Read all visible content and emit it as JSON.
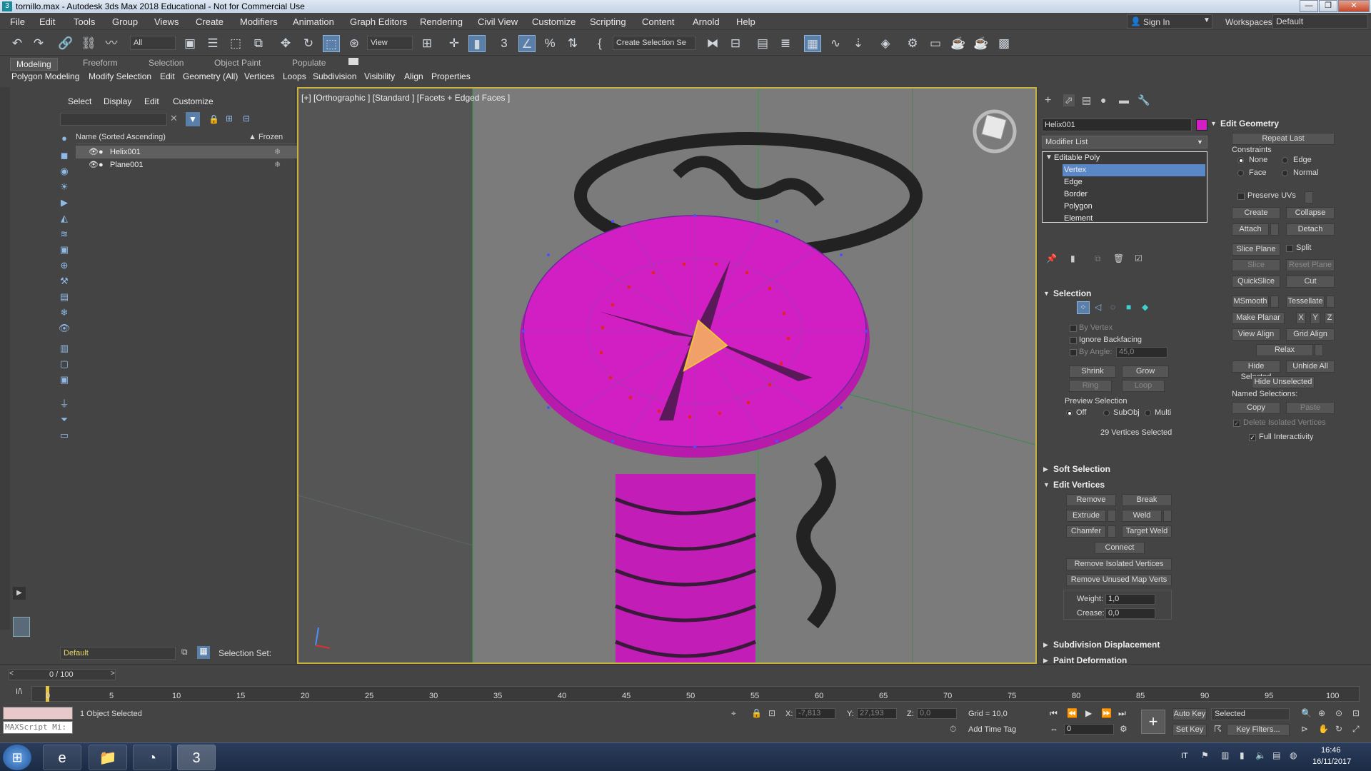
{
  "window": {
    "title": "tornillo.max - Autodesk 3ds Max 2018 Educational - Not for Commercial Use",
    "controls": [
      "—",
      "❐",
      "✕"
    ]
  },
  "menu": [
    "File",
    "Edit",
    "Tools",
    "Group",
    "Views",
    "Create",
    "Modifiers",
    "Animation",
    "Graph Editors",
    "Rendering",
    "Civil View",
    "Customize",
    "Scripting",
    "Content",
    "Arnold",
    "Help"
  ],
  "account": {
    "sign_in": "Sign In",
    "workspaces_label": "Workspaces:",
    "workspace": "Default"
  },
  "toolbar": {
    "filter": "All",
    "view": "View",
    "selection_set": "Create Selection Se"
  },
  "ribbon": {
    "tabs": [
      "Modeling",
      "Freeform",
      "Selection",
      "Object Paint",
      "Populate"
    ],
    "sub": [
      "Polygon Modeling",
      "Modify Selection",
      "Edit",
      "Geometry (All)",
      "Vertices",
      "Loops",
      "Subdivision",
      "Visibility",
      "Align",
      "Properties"
    ]
  },
  "scene_explorer": {
    "tabs": [
      "Select",
      "Display",
      "Edit",
      "Customize"
    ],
    "col_name": "Name (Sorted Ascending)",
    "col_frozen": "▲ Frozen",
    "rows": [
      "Helix001",
      "Plane001"
    ],
    "layer": "Default",
    "selection_set_label": "Selection Set:"
  },
  "viewport": {
    "label": "[+] [Orthographic ] [Standard ] [Facets + Edged Faces ]",
    "mesh_color": "#d21fc4",
    "vertex_color": "#e0232b"
  },
  "command_panel": {
    "object_name": "Helix001",
    "object_color": "#d21fc4",
    "modifier_list": "Modifier List",
    "stack": [
      "Editable Poly",
      "Vertex",
      "Edge",
      "Border",
      "Polygon",
      "Element"
    ],
    "selection": {
      "title": "Selection",
      "by_vertex": "By Vertex",
      "ignore_backfacing": "Ignore Backfacing",
      "by_angle": "By Angle:",
      "by_angle_value": "45,0",
      "shrink": "Shrink",
      "grow": "Grow",
      "ring": "Ring",
      "loop": "Loop",
      "preview_title": "Preview Selection",
      "preview_off": "Off",
      "preview_subobj": "SubObj",
      "preview_multi": "Multi",
      "count": "29 Vertices Selected"
    },
    "soft_selection": "Soft Selection",
    "edit_vertices": {
      "title": "Edit Vertices",
      "remove": "Remove",
      "break": "Break",
      "extrude": "Extrude",
      "weld": "Weld",
      "chamfer": "Chamfer",
      "target_weld": "Target Weld",
      "connect": "Connect",
      "remove_isolated": "Remove Isolated Vertices",
      "remove_unused": "Remove Unused Map Verts",
      "weight_label": "Weight:",
      "weight": "1,0",
      "crease_label": "Crease:",
      "crease": "0,0"
    },
    "subdivision_displacement": "Subdivision Displacement",
    "paint_deformation": "Paint Deformation",
    "edit_geometry": {
      "title": "Edit Geometry",
      "repeat_last": "Repeat Last",
      "constraints": "Constraints",
      "c_none": "None",
      "c_edge": "Edge",
      "c_face": "Face",
      "c_normal": "Normal",
      "preserve_uvs": "Preserve UVs",
      "create": "Create",
      "collapse": "Collapse",
      "attach": "Attach",
      "detach": "Detach",
      "slice_plane": "Slice Plane",
      "split": "Split",
      "slice": "Slice",
      "reset_plane": "Reset Plane",
      "quickslice": "QuickSlice",
      "cut": "Cut",
      "msmooth": "MSmooth",
      "tessellate": "Tessellate",
      "make_planar": "Make Planar",
      "x": "X",
      "y": "Y",
      "z": "Z",
      "view_align": "View Align",
      "grid_align": "Grid Align",
      "relax": "Relax",
      "hide_selected": "Hide Selected",
      "unhide_all": "Unhide All",
      "hide_unselected": "Hide Unselected",
      "named_selections": "Named Selections:",
      "copy": "Copy",
      "paste": "Paste",
      "delete_isolated": "Delete Isolated Vertices",
      "full_interactivity": "Full Interactivity"
    }
  },
  "timeline": {
    "frame": "0 / 100",
    "ticks": [
      "0",
      "5",
      "10",
      "15",
      "20",
      "25",
      "30",
      "35",
      "40",
      "45",
      "50",
      "55",
      "60",
      "65",
      "70",
      "75",
      "80",
      "85",
      "90",
      "95",
      "100"
    ]
  },
  "status": {
    "maxscript": "MAXScript Mi:",
    "objects_selected": "1 Object Selected",
    "x_label": "X:",
    "x": "-7,813",
    "y_label": "Y:",
    "y": "27,193",
    "z_label": "Z:",
    "z": "0,0",
    "grid": "Grid = 10,0",
    "add_time_tag": "Add Time Tag",
    "auto_key": "Auto Key",
    "set_key": "Set Key",
    "key_mode": "Selected",
    "key_filters": "Key Filters...",
    "current_frame": "0"
  },
  "taskbar": {
    "lang": "IT",
    "time": "16:46",
    "date": "16/11/2017"
  }
}
